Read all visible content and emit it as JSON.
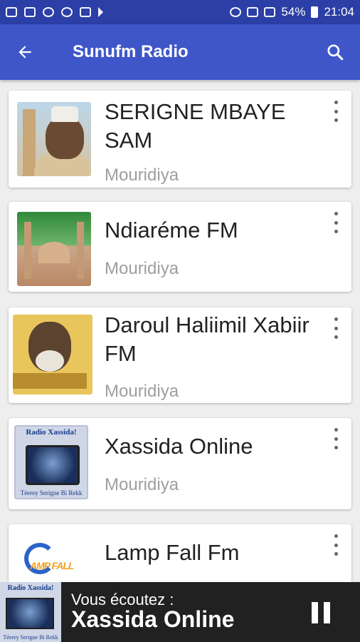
{
  "status_bar": {
    "battery": "54%",
    "time": "21:04"
  },
  "app_bar": {
    "title": "Sunufm Radio",
    "back_icon": "arrow-left-icon",
    "search_icon": "search-icon"
  },
  "stations": [
    {
      "name": "SERIGNE MBAYE SAM",
      "category": "Mouridiya"
    },
    {
      "name": "Ndiaréme FM",
      "category": "Mouridiya"
    },
    {
      "name": "Daroul Haliimil Xabiir FM",
      "category": "Mouridiya"
    },
    {
      "name": "Xassida Online",
      "category": "Mouridiya",
      "logo_top": "Radio Xassida!",
      "logo_bottom": "Téerey Serigne Bi Rekk"
    },
    {
      "name": "Lamp Fall Fm",
      "logo_text": "AMP FALL"
    }
  ],
  "player": {
    "label": "Vous écoutez :",
    "station": "Xassida Online",
    "logo_top": "Radio Xassida!",
    "logo_bottom": "Téerey Serigne Bi Rekk",
    "pause_icon": "pause-icon"
  },
  "colors": {
    "status_bar": "#2b3fa6",
    "app_bar": "#3f56c9",
    "player": "#212121"
  }
}
